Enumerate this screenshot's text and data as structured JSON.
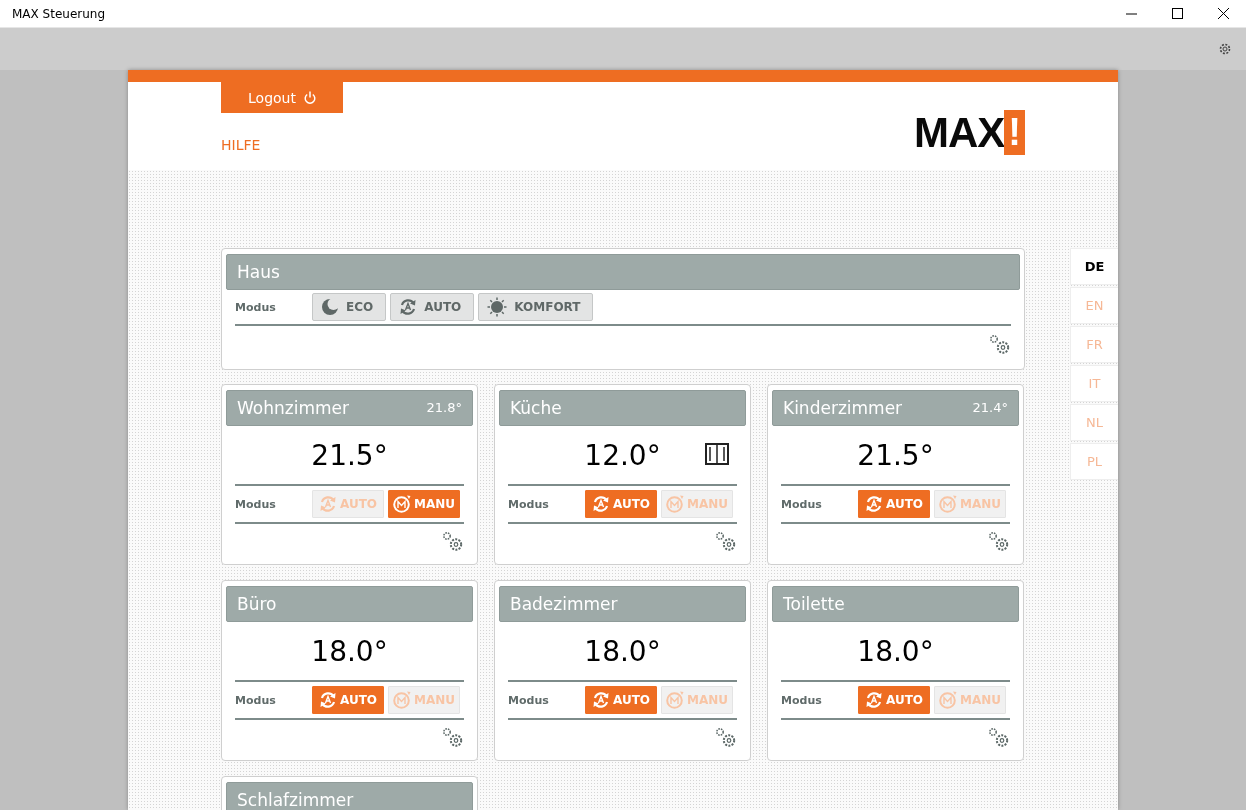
{
  "window": {
    "title": "MAX Steuerung"
  },
  "header": {
    "logout": "Logout",
    "help": "HILFE",
    "logo": {
      "text": "MAX",
      "mark": "!"
    }
  },
  "house": {
    "name": "Haus",
    "mode_label": "Modus",
    "buttons": [
      {
        "kind": "eco",
        "label": "ECO",
        "selected": false
      },
      {
        "kind": "auto",
        "label": "AUTO",
        "selected": false
      },
      {
        "kind": "komfort",
        "label": "KOMFORT",
        "selected": false
      }
    ]
  },
  "rooms": [
    {
      "name": "Wohnzimmer",
      "reading": "21.8°",
      "setpoint": "21.5°",
      "window_open": false,
      "mode_label": "Modus",
      "buttons": [
        {
          "kind": "auto",
          "label": "AUTO",
          "selected": false
        },
        {
          "kind": "manu",
          "label": "MANU",
          "selected": true
        }
      ]
    },
    {
      "name": "Küche",
      "setpoint": "12.0°",
      "window_open": true,
      "mode_label": "Modus",
      "buttons": [
        {
          "kind": "auto",
          "label": "AUTO",
          "selected": true
        },
        {
          "kind": "manu",
          "label": "MANU",
          "selected": false
        }
      ]
    },
    {
      "name": "Kinderzimmer",
      "reading": "21.4°",
      "setpoint": "21.5°",
      "window_open": false,
      "mode_label": "Modus",
      "buttons": [
        {
          "kind": "auto",
          "label": "AUTO",
          "selected": true
        },
        {
          "kind": "manu",
          "label": "MANU",
          "selected": false
        }
      ]
    },
    {
      "name": "Büro",
      "setpoint": "18.0°",
      "window_open": false,
      "mode_label": "Modus",
      "buttons": [
        {
          "kind": "auto",
          "label": "AUTO",
          "selected": true
        },
        {
          "kind": "manu",
          "label": "MANU",
          "selected": false
        }
      ]
    },
    {
      "name": "Badezimmer",
      "setpoint": "18.0°",
      "window_open": false,
      "mode_label": "Modus",
      "buttons": [
        {
          "kind": "auto",
          "label": "AUTO",
          "selected": true
        },
        {
          "kind": "manu",
          "label": "MANU",
          "selected": false
        }
      ]
    },
    {
      "name": "Toilette",
      "setpoint": "18.0°",
      "window_open": false,
      "mode_label": "Modus",
      "buttons": [
        {
          "kind": "auto",
          "label": "AUTO",
          "selected": true
        },
        {
          "kind": "manu",
          "label": "MANU",
          "selected": false
        }
      ]
    },
    {
      "name": "Schlafzimmer"
    }
  ],
  "languages": [
    {
      "label": "DE",
      "selected": true
    },
    {
      "label": "EN",
      "selected": false
    },
    {
      "label": "FR",
      "selected": false
    },
    {
      "label": "IT",
      "selected": false
    },
    {
      "label": "NL",
      "selected": false
    },
    {
      "label": "PL",
      "selected": false
    }
  ]
}
